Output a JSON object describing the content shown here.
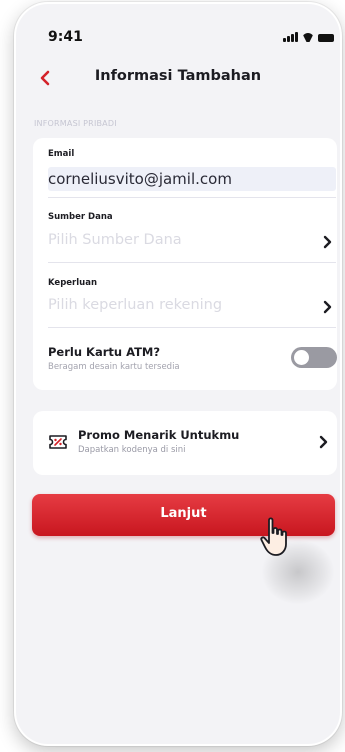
{
  "status_bar": {
    "time": "9:41"
  },
  "header": {
    "title": "Informasi Tambahan"
  },
  "section": {
    "label": "INFORMASI PRIBADI"
  },
  "form": {
    "email": {
      "label": "Email",
      "value": "corneliusvito@jamil.com"
    },
    "source_of_funds": {
      "label": "Sumber Dana",
      "placeholder": "Pilih Sumber Dana"
    },
    "purpose": {
      "label": "Keperluan",
      "placeholder": "Pilih keperluan rekening"
    },
    "atm_card": {
      "title": "Perlu Kartu ATM?",
      "subtitle": "Beragam desain kartu tersedia",
      "enabled": false
    }
  },
  "promo": {
    "title": "Promo Menarik Untukmu",
    "subtitle": "Dapatkan kodenya di sini"
  },
  "continue_button": {
    "label": "Lanjut"
  },
  "icons": [
    "signal-icon",
    "wifi-icon",
    "battery-icon",
    "back-icon",
    "chevron-right-icon",
    "promo-ticket-icon",
    "hand-cursor-icon"
  ],
  "colors": {
    "accent": "#d4222a",
    "toggle_off": "#9a9aa2",
    "background": "#f3f3f6",
    "placeholder": "#dadae2"
  }
}
